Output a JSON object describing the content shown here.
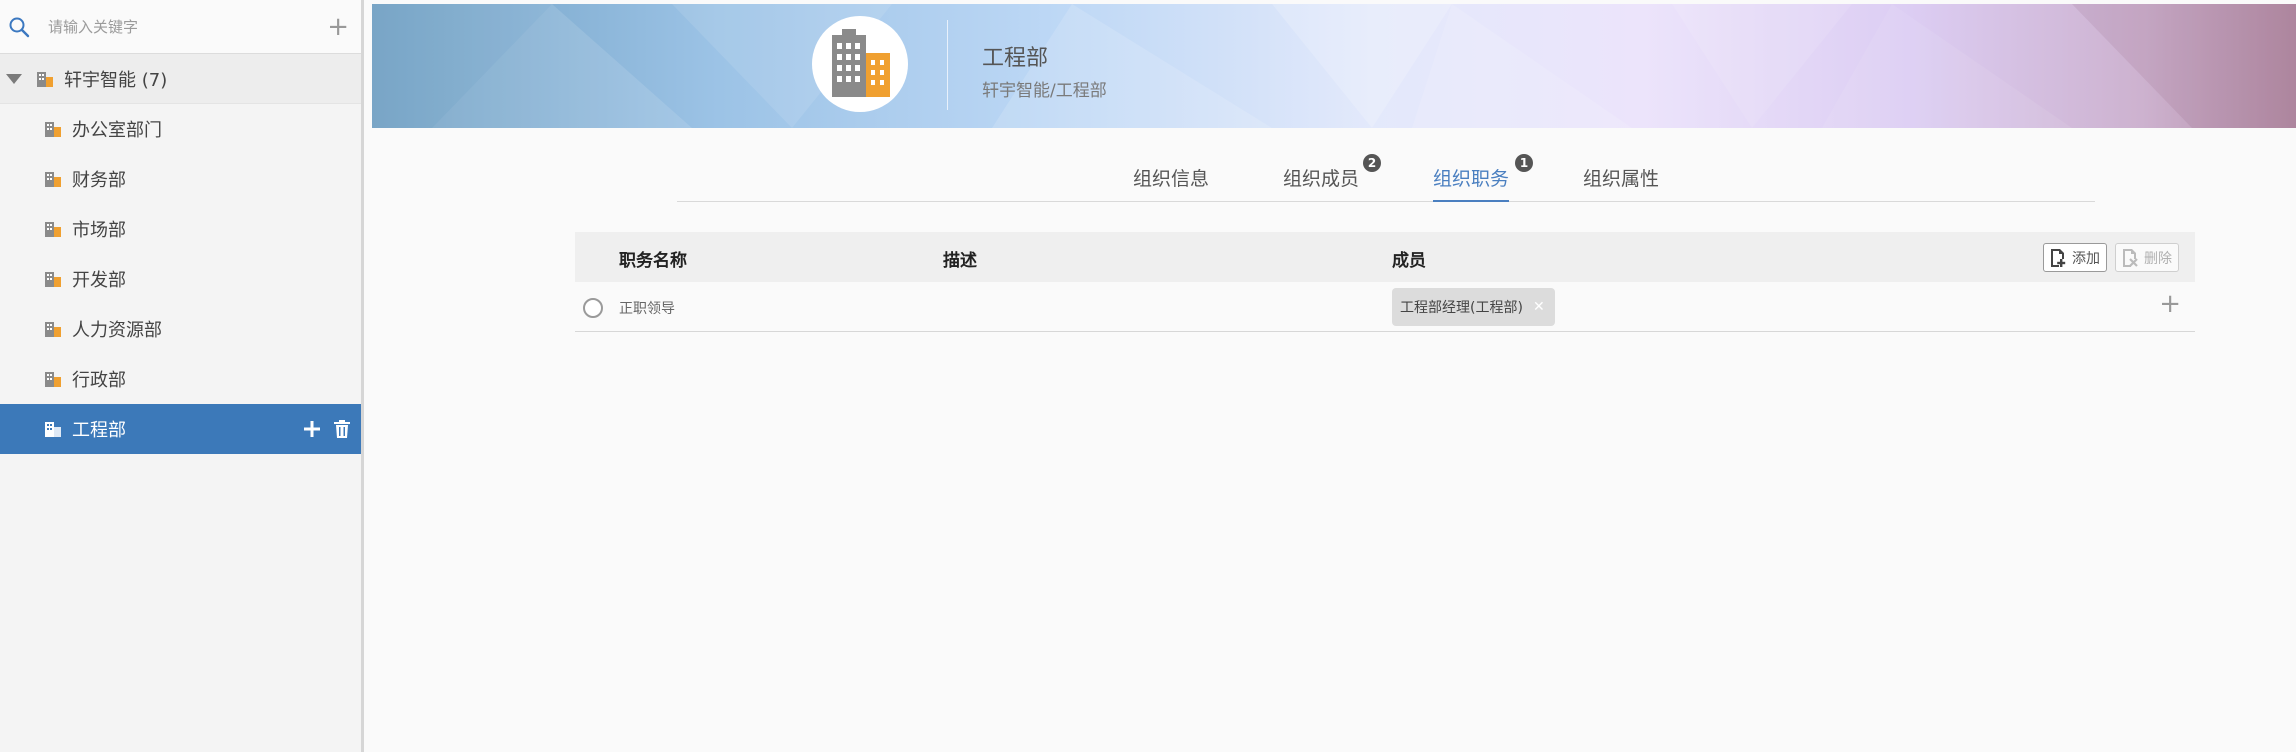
{
  "search": {
    "placeholder": "请输入关键字"
  },
  "tree": {
    "root_label": "轩宇智能 (7)",
    "items": [
      {
        "label": "办公室部门"
      },
      {
        "label": "财务部"
      },
      {
        "label": "市场部"
      },
      {
        "label": "开发部"
      },
      {
        "label": "人力资源部"
      },
      {
        "label": "行政部"
      },
      {
        "label": "工程部",
        "selected": true
      }
    ]
  },
  "header": {
    "title": "工程部",
    "path": "轩宇智能/工程部"
  },
  "tabs": [
    {
      "label": "组织信息",
      "badge": ""
    },
    {
      "label": "组织成员",
      "badge": "2"
    },
    {
      "label": "组织职务",
      "badge": "1",
      "active": true
    },
    {
      "label": "组织属性",
      "badge": ""
    }
  ],
  "table": {
    "columns": [
      "职务名称",
      "描述",
      "成员"
    ],
    "add_label": "添加",
    "delete_label": "删除",
    "rows": [
      {
        "name": "正职领导",
        "description": "",
        "members": [
          "工程部经理(工程部)"
        ]
      }
    ]
  },
  "colors": {
    "selected_bg": "#3c79b9",
    "accent": "#4a7fc0",
    "building_orange": "#f0a030",
    "building_gray": "#8a8a8a"
  }
}
